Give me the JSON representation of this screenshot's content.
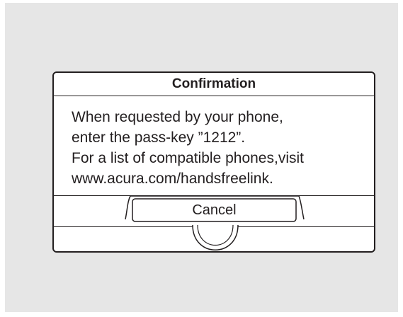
{
  "dialog": {
    "title": "Confirmation",
    "message_lines": [
      "When requested by your phone,",
      "enter the pass-key ”1212”.",
      "For a list of compatible phones,visit",
      "www.acura.com/handsfreelink."
    ],
    "cancel_label": "Cancel"
  },
  "colors": {
    "screen_background": "#e6e6e6",
    "dialog_background": "#ffffff",
    "line_color": "#231f20"
  }
}
